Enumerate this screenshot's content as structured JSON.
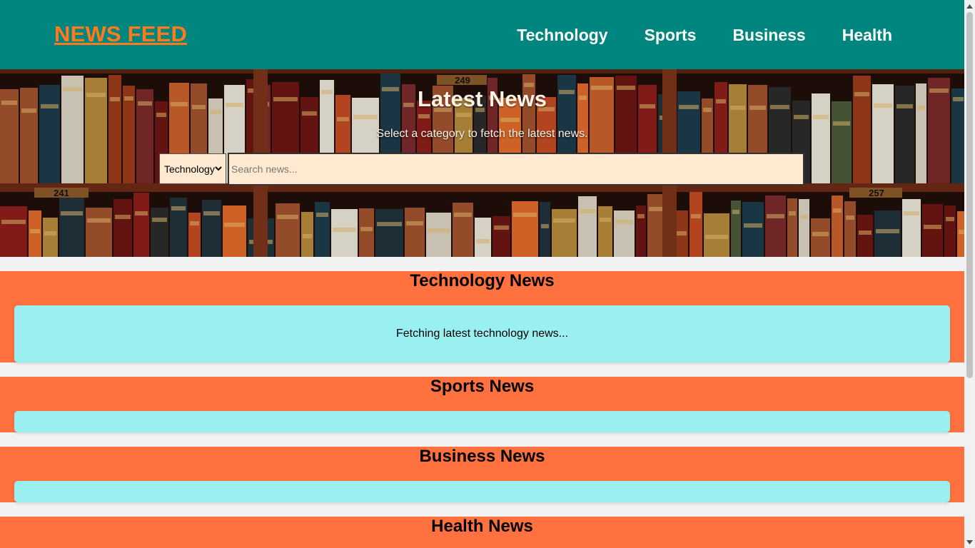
{
  "header": {
    "logo": "NEWS FEED",
    "nav": [
      "Technology",
      "Sports",
      "Business",
      "Health"
    ]
  },
  "hero": {
    "title": "Latest News",
    "subtitle": "Select a category to fetch the latest news.",
    "select_value": "Technology",
    "search_placeholder": "Search news...",
    "shelf_labels": [
      "249",
      "241",
      "257"
    ]
  },
  "sections": [
    {
      "title": "Technology News",
      "content": "Fetching latest technology news..."
    },
    {
      "title": "Sports News",
      "content": ""
    },
    {
      "title": "Business News",
      "content": ""
    },
    {
      "title": "Health News",
      "content": ""
    }
  ],
  "colors": {
    "header": "#00857f",
    "logo": "#ff7a1a",
    "section": "#ff7240",
    "news_box": "#9aeff0",
    "input": "#ffe9d0",
    "page": "#f2f2f2"
  }
}
